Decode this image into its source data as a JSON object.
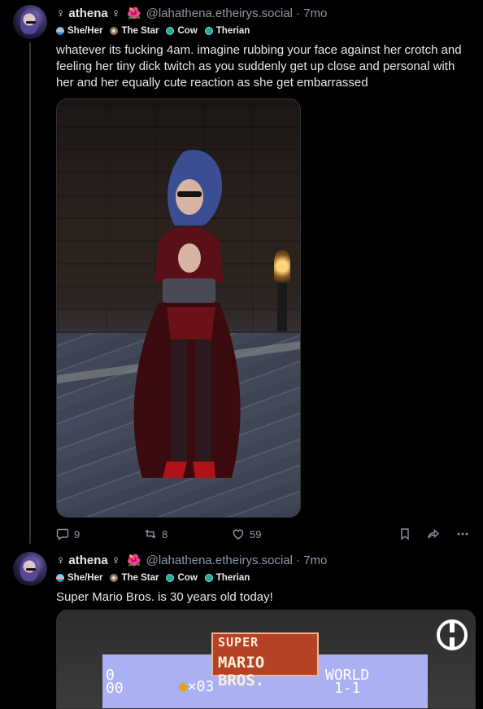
{
  "posts": [
    {
      "display_name": "♀ athena ♀",
      "emoji": "🌺",
      "handle": "@lahathena.etheirys.social",
      "time": "· 7mo",
      "badges": [
        "She/Her",
        "The Star",
        "Cow",
        "Therian"
      ],
      "text": "whatever its fucking 4am. imagine rubbing your face against her crotch and feeling her tiny dick twitch as you suddenly get up close and personal with her and her equally cute reaction as she get embarrassed",
      "replies": "9",
      "reposts": "8",
      "likes": "59"
    },
    {
      "display_name": "♀ athena ♀",
      "emoji": "🌺",
      "handle": "@lahathena.etheirys.social",
      "time": "· 7mo",
      "badges": [
        "She/Her",
        "The Star",
        "Cow",
        "Therian"
      ],
      "text": "Super Mario Bros. is 30 years old today!",
      "media": {
        "title_line1": "SUPER",
        "title_line2": "MARIO BROS.",
        "hud_left_top": "0",
        "hud_left_bottom": "00",
        "hud_coins": "×03",
        "hud_world": "WORLD",
        "hud_level": "1-1"
      }
    }
  ],
  "colors": {
    "background": "#000000",
    "text": "#e7e9ea",
    "muted": "#8b98a5",
    "border": "#2f3336"
  }
}
